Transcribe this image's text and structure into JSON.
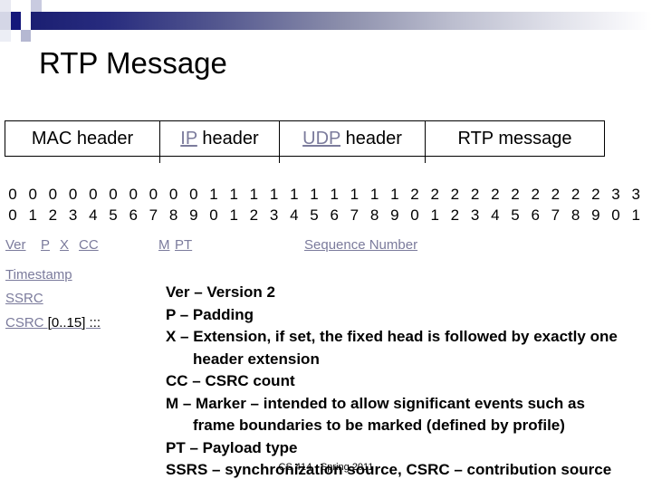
{
  "slide": {
    "title": "RTP Message",
    "footer": "CS 414 - Spring 2011"
  },
  "theme": {
    "link_color": "#7b7b9c",
    "gradient_start": "#1b1f72",
    "gradient_end": "#ffffff",
    "text_color": "#000000"
  },
  "protocol_stack": {
    "cells": [
      {
        "label": "MAC header",
        "link": false
      },
      {
        "label_link": "IP",
        "label_rest": " header",
        "link": true
      },
      {
        "label_link": "UDP",
        "label_rest": " header",
        "link": true
      },
      {
        "label": "RTP message",
        "link": false
      }
    ]
  },
  "bit_ruler": {
    "tens": [
      "0",
      "0",
      "0",
      "0",
      "0",
      "0",
      "0",
      "0",
      "0",
      "0",
      "1",
      "1",
      "1",
      "1",
      "1",
      "1",
      "1",
      "1",
      "1",
      "1",
      "2",
      "2",
      "2",
      "2",
      "2",
      "2",
      "2",
      "2",
      "2",
      "2",
      "3",
      "3"
    ],
    "ones": [
      "0",
      "1",
      "2",
      "3",
      "4",
      "5",
      "6",
      "7",
      "8",
      "9",
      "0",
      "1",
      "2",
      "3",
      "4",
      "5",
      "6",
      "7",
      "8",
      "9",
      "0",
      "1",
      "2",
      "3",
      "4",
      "5",
      "6",
      "7",
      "8",
      "9",
      "0",
      "1"
    ]
  },
  "header_fields": {
    "row1": [
      {
        "label": "Ver"
      },
      {
        "label": "P"
      },
      {
        "label": "X"
      },
      {
        "label": "CC"
      },
      {
        "label": "M"
      },
      {
        "label": "PT"
      },
      {
        "label": "Sequence Number"
      }
    ],
    "row2": [
      {
        "label": "Timestamp"
      },
      {
        "label": "SSRC"
      }
    ],
    "row3": {
      "link_label": "CSRC",
      "suffix": " [0..15] :::"
    }
  },
  "legend": {
    "lines": [
      {
        "text": "Ver – Version 2",
        "indent": false
      },
      {
        "text": "P – Padding",
        "indent": false
      },
      {
        "text": "X – Extension, if set, the fixed head is followed by exactly one",
        "indent": false
      },
      {
        "text": "header extension",
        "indent": true
      },
      {
        "text": "CC – CSRC count",
        "indent": false
      },
      {
        "text": "M – Marker – intended to allow significant events such as",
        "indent": false
      },
      {
        "text": "frame boundaries to be  marked (defined by profile)",
        "indent": true
      },
      {
        "text": "PT – Payload type",
        "indent": false
      },
      {
        "text": "SSRS – synchronization source, CSRC – contribution source",
        "indent": false
      }
    ]
  }
}
